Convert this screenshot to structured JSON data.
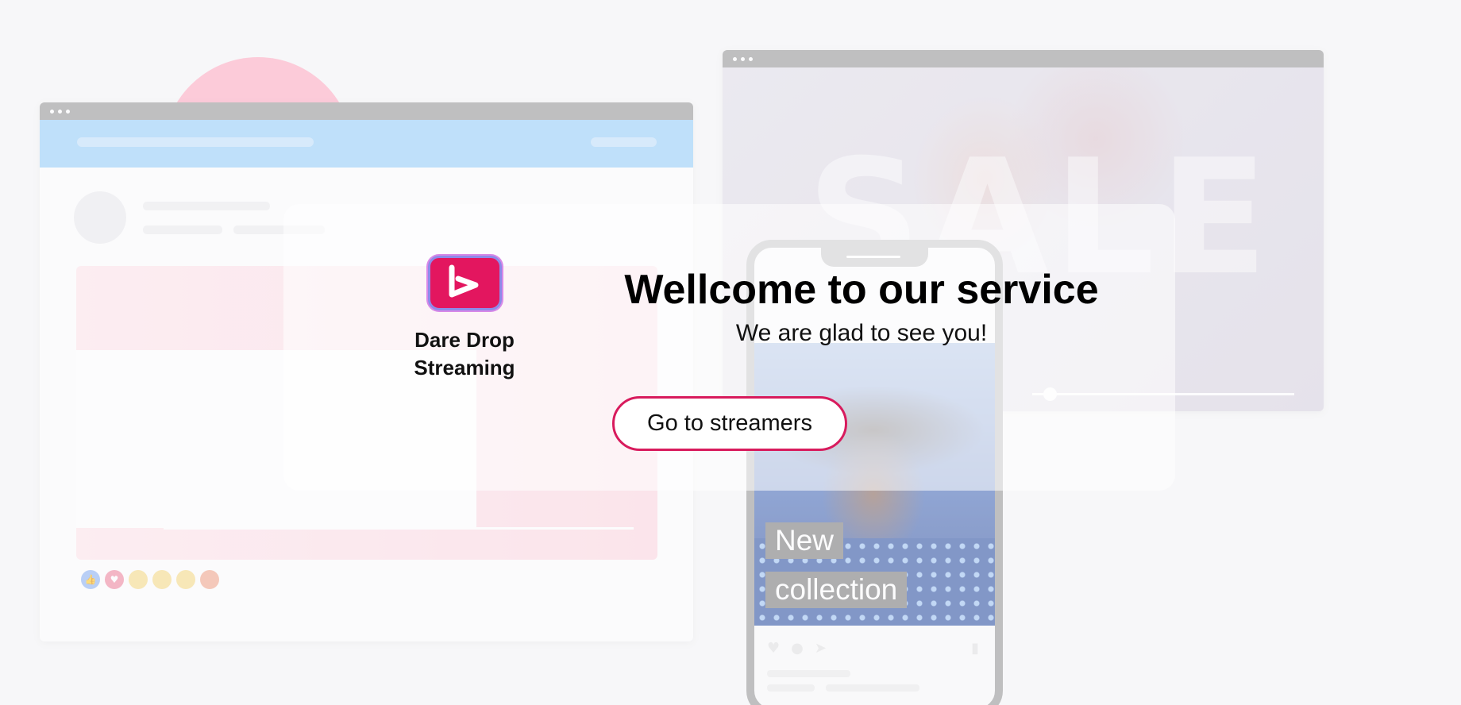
{
  "brand": {
    "name": "Dare Drop\nStreaming",
    "logo_icon": "dare-drop-b-logo",
    "accent_color": "#e3165f"
  },
  "welcome": {
    "title": "Wellcome to our service",
    "subtitle": "We are glad to see you!",
    "cta_label": "Go to streamers"
  },
  "background": {
    "hero_text": "SALE",
    "phone_tags": [
      "New",
      "collection"
    ]
  }
}
